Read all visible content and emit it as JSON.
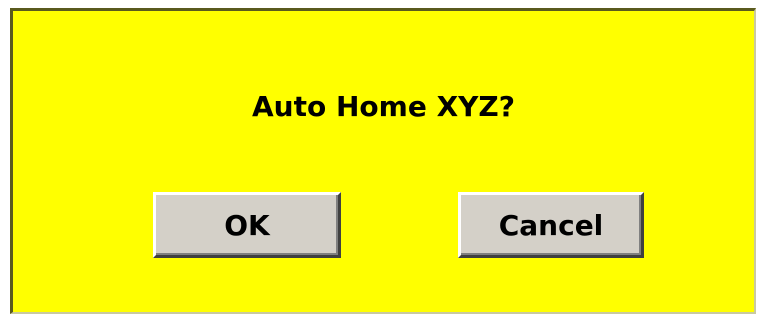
{
  "dialog": {
    "message": "Auto Home XYZ?",
    "ok_label": "OK",
    "cancel_label": "Cancel",
    "background_color": "#ffff00"
  }
}
